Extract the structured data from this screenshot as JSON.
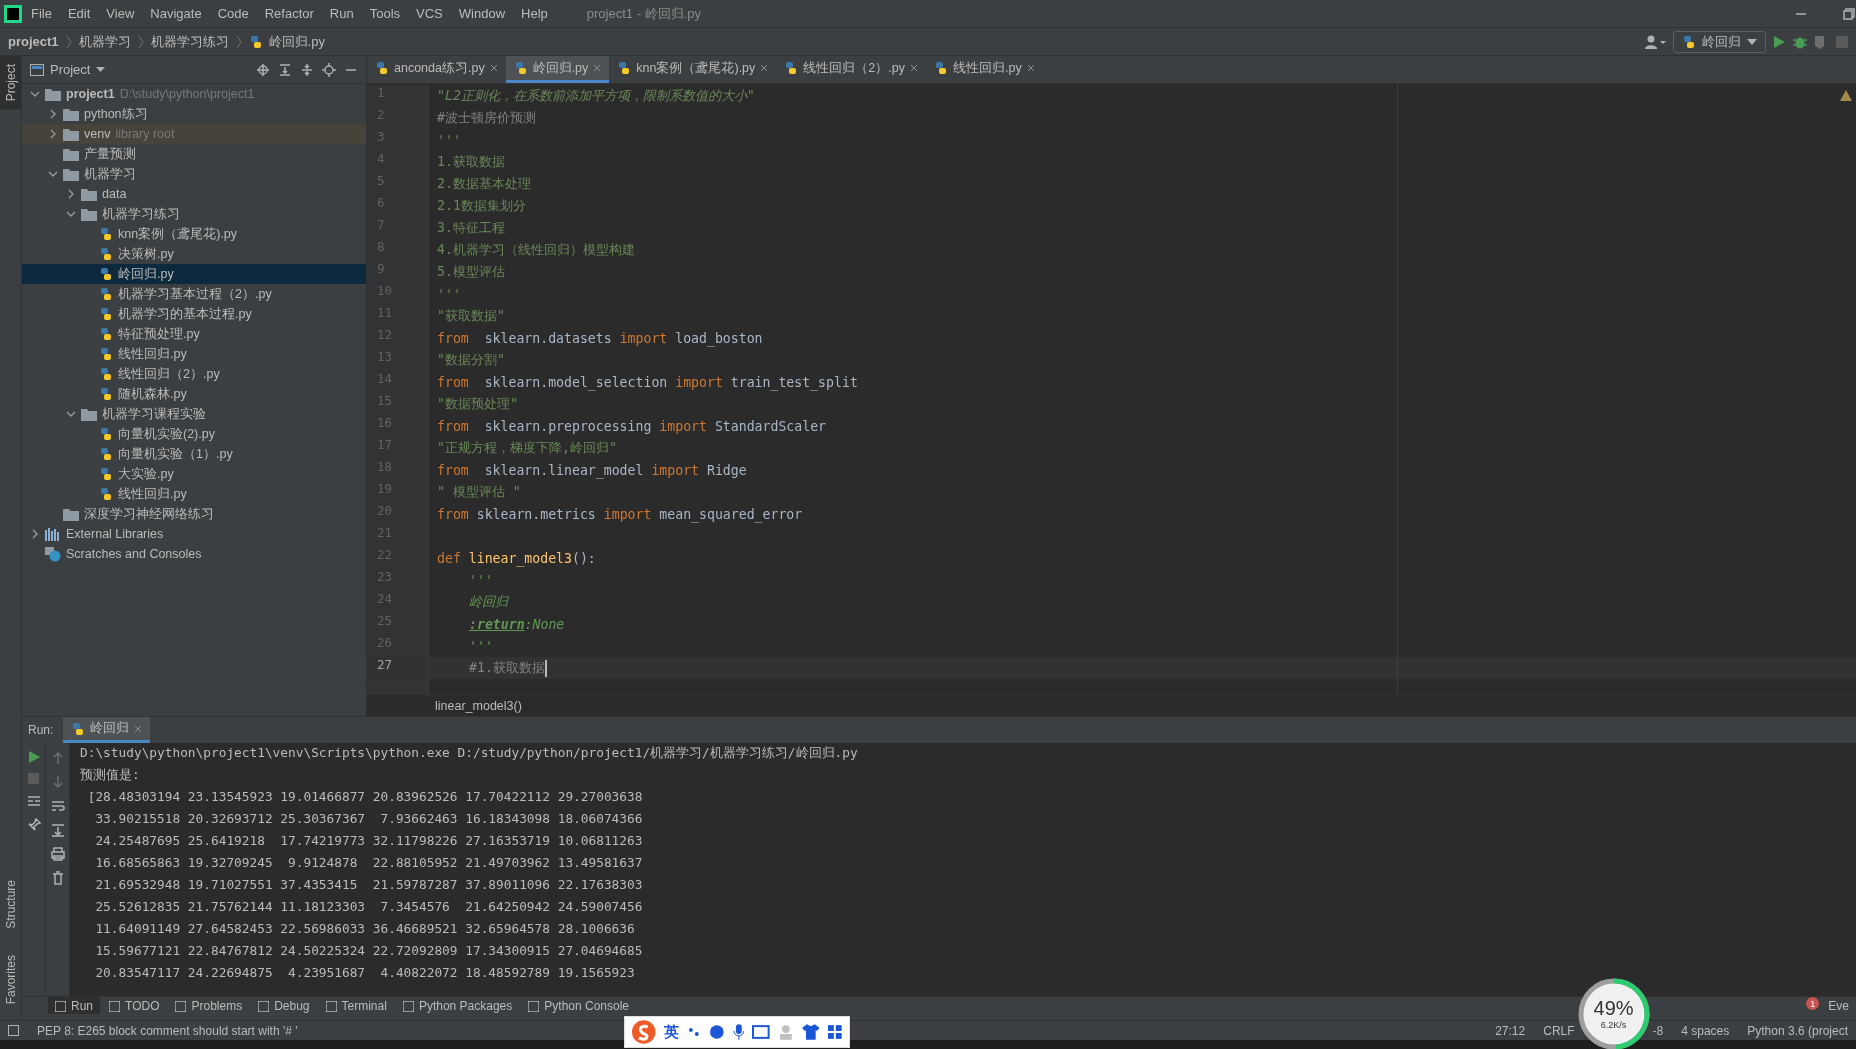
{
  "window": {
    "title": "project1 - 岭回归.py"
  },
  "menu": [
    "File",
    "Edit",
    "View",
    "Navigate",
    "Code",
    "Refactor",
    "Run",
    "Tools",
    "VCS",
    "Window",
    "Help"
  ],
  "breadcrumbs": [
    "project1",
    "机器学习",
    "机器学习练习",
    "岭回归.py"
  ],
  "run_config": {
    "label": "岭回归"
  },
  "side_strip": {
    "top": [
      {
        "label": "Project",
        "selected": true
      }
    ],
    "bottom": [
      {
        "label": "Structure",
        "selected": false
      },
      {
        "label": "Favorites",
        "selected": false
      }
    ]
  },
  "project_panel": {
    "title": "Project",
    "tree": [
      {
        "label": "project1",
        "hint": "D:\\study\\python\\project1",
        "kind": "root",
        "expanded": true,
        "selected": false,
        "children": [
          {
            "label": "python练习",
            "kind": "folder",
            "expanded": false,
            "selected": false
          },
          {
            "label": "venv",
            "hint": "library root",
            "kind": "library",
            "expanded": false,
            "selected": false
          },
          {
            "label": "产量预测",
            "kind": "folder",
            "selected": false
          },
          {
            "label": "机器学习",
            "kind": "folder",
            "expanded": true,
            "selected": false,
            "children": [
              {
                "label": "data",
                "kind": "folder",
                "expanded": false,
                "selected": false
              },
              {
                "label": "机器学习练习",
                "kind": "folder",
                "expanded": true,
                "selected": false,
                "children": [
                  {
                    "label": "knn案例（鸢尾花).py",
                    "kind": "file",
                    "selected": false
                  },
                  {
                    "label": "决策树.py",
                    "kind": "file",
                    "selected": false
                  },
                  {
                    "label": "岭回归.py",
                    "kind": "file",
                    "selected": true
                  },
                  {
                    "label": "机器学习基本过程（2）.py",
                    "kind": "file",
                    "selected": false
                  },
                  {
                    "label": "机器学习的基本过程.py",
                    "kind": "file",
                    "selected": false
                  },
                  {
                    "label": "特征预处理.py",
                    "kind": "file",
                    "selected": false
                  },
                  {
                    "label": "线性回归.py",
                    "kind": "file",
                    "selected": false
                  },
                  {
                    "label": "线性回归（2）.py",
                    "kind": "file",
                    "selected": false
                  },
                  {
                    "label": "随机森林.py",
                    "kind": "file",
                    "selected": false
                  }
                ]
              },
              {
                "label": "机器学习课程实验",
                "kind": "folder",
                "expanded": true,
                "selected": false,
                "children": [
                  {
                    "label": "向量机实验(2).py",
                    "kind": "file",
                    "selected": false
                  },
                  {
                    "label": "向量机实验（1）.py",
                    "kind": "file",
                    "selected": false
                  },
                  {
                    "label": "大实验.py",
                    "kind": "file",
                    "selected": false
                  },
                  {
                    "label": "线性回归.py",
                    "kind": "file",
                    "selected": false
                  }
                ]
              }
            ]
          },
          {
            "label": "深度学习神经网络练习",
            "kind": "folder",
            "selected": false
          }
        ]
      },
      {
        "label": "External Libraries",
        "kind": "libraries",
        "expanded": false,
        "selected": false
      },
      {
        "label": "Scratches and Consoles",
        "kind": "scratches",
        "selected": false
      }
    ]
  },
  "editor": {
    "tabs": [
      {
        "label": "anconda练习.py",
        "selected": false
      },
      {
        "label": "岭回归.py",
        "selected": true
      },
      {
        "label": "knn案例（鸢尾花).py",
        "selected": false
      },
      {
        "label": "线性回归（2）.py",
        "selected": false
      },
      {
        "label": "线性回归.py",
        "selected": false
      }
    ],
    "lines": [
      {
        "number": "1",
        "current": false,
        "tokens": [
          {
            "kind": "istring",
            "text": "\"L2正则化，在系数前添加平方项，限制系数值的大小\""
          }
        ]
      },
      {
        "number": "2",
        "current": false,
        "tokens": [
          {
            "kind": "comment",
            "text": "#波士顿房价预测"
          }
        ]
      },
      {
        "number": "3",
        "current": false,
        "tokens": [
          {
            "kind": "string",
            "text": "'''"
          }
        ]
      },
      {
        "number": "4",
        "current": false,
        "tokens": [
          {
            "kind": "string",
            "text": "1.获取数据"
          }
        ]
      },
      {
        "number": "5",
        "current": false,
        "tokens": [
          {
            "kind": "string",
            "text": "2.数据基本处理"
          }
        ]
      },
      {
        "number": "6",
        "current": false,
        "tokens": [
          {
            "kind": "string",
            "text": "2.1数据集划分"
          }
        ]
      },
      {
        "number": "7",
        "current": false,
        "tokens": [
          {
            "kind": "string",
            "text": "3.特征工程"
          }
        ]
      },
      {
        "number": "8",
        "current": false,
        "tokens": [
          {
            "kind": "string",
            "text": "4.机器学习（线性回归）模型构建"
          }
        ]
      },
      {
        "number": "9",
        "current": false,
        "tokens": [
          {
            "kind": "string",
            "text": "5.模型评估"
          }
        ]
      },
      {
        "number": "10",
        "current": false,
        "tokens": [
          {
            "kind": "string",
            "text": "'''"
          }
        ]
      },
      {
        "number": "11",
        "current": false,
        "tokens": [
          {
            "kind": "string",
            "text": "\"获取数据\""
          }
        ]
      },
      {
        "number": "12",
        "current": false,
        "tokens": [
          {
            "kind": "keyword",
            "text": "from"
          },
          {
            "kind": "plain",
            "text": "  sklearn.datasets "
          },
          {
            "kind": "keyword",
            "text": "import"
          },
          {
            "kind": "plain",
            "text": " load_boston"
          }
        ]
      },
      {
        "number": "13",
        "current": false,
        "tokens": [
          {
            "kind": "string",
            "text": "\"数据分割\""
          }
        ]
      },
      {
        "number": "14",
        "current": false,
        "tokens": [
          {
            "kind": "keyword",
            "text": "from"
          },
          {
            "kind": "plain",
            "text": "  sklearn.model_selection "
          },
          {
            "kind": "keyword",
            "text": "import"
          },
          {
            "kind": "plain",
            "text": " train_test_split"
          }
        ]
      },
      {
        "number": "15",
        "current": false,
        "tokens": [
          {
            "kind": "string",
            "text": "\"数据预处理\""
          }
        ]
      },
      {
        "number": "16",
        "current": false,
        "tokens": [
          {
            "kind": "keyword",
            "text": "from"
          },
          {
            "kind": "plain",
            "text": "  sklearn.preprocessing "
          },
          {
            "kind": "keyword",
            "text": "import"
          },
          {
            "kind": "plain",
            "text": " StandardScaler"
          }
        ]
      },
      {
        "number": "17",
        "current": false,
        "tokens": [
          {
            "kind": "string",
            "text": "\"正规方程，梯度下降,岭回归\""
          }
        ]
      },
      {
        "number": "18",
        "current": false,
        "tokens": [
          {
            "kind": "keyword",
            "text": "from"
          },
          {
            "kind": "plain",
            "text": "  sklearn.linear_model "
          },
          {
            "kind": "keyword",
            "text": "import"
          },
          {
            "kind": "plain",
            "text": " Ridge"
          }
        ]
      },
      {
        "number": "19",
        "current": false,
        "tokens": [
          {
            "kind": "string",
            "text": "\" 模型评估 \""
          }
        ]
      },
      {
        "number": "20",
        "current": false,
        "tokens": [
          {
            "kind": "keyword",
            "text": "from"
          },
          {
            "kind": "plain",
            "text": " sklearn.metrics "
          },
          {
            "kind": "keyword",
            "text": "import"
          },
          {
            "kind": "plain",
            "text": " mean_squared_error"
          }
        ]
      },
      {
        "number": "21",
        "current": false
      },
      {
        "number": "22",
        "current": false,
        "tokens": [
          {
            "kind": "keyword",
            "text": "def "
          },
          {
            "kind": "function",
            "text": "linear_model3"
          },
          {
            "kind": "plain",
            "text": "():"
          }
        ]
      },
      {
        "number": "23",
        "current": false,
        "indented": true,
        "tokens": [
          {
            "kind": "doc",
            "text": "'''"
          }
        ]
      },
      {
        "number": "24",
        "current": false,
        "indented": true,
        "tokens": [
          {
            "kind": "doc",
            "text": "岭回归"
          }
        ]
      },
      {
        "number": "25",
        "current": false,
        "indented": true,
        "tokens": [
          {
            "kind": "doctag",
            "text": ":return"
          },
          {
            "kind": "doc",
            "text": ":None"
          }
        ]
      },
      {
        "number": "26",
        "current": false,
        "indented": true,
        "tokens": [
          {
            "kind": "doc",
            "text": "'''"
          }
        ]
      },
      {
        "number": "27",
        "current": true,
        "indented": true,
        "tokens": [
          {
            "kind": "comment",
            "text": "#1.获取数据"
          }
        ]
      }
    ],
    "breadcrumb": "linear_model3()"
  },
  "run_panel": {
    "label": "Run:",
    "tabs": [
      {
        "label": "岭回归",
        "selected": true
      }
    ],
    "output": [
      "D:\\study\\python\\project1\\venv\\Scripts\\python.exe D:/study/python/project1/机器学习/机器学习练习/岭回归.py",
      "预测值是:",
      " [28.48303194 23.13545923 19.01466877 20.83962526 17.70422112 29.27003638",
      "  33.90215518 20.32693712 25.30367367  7.93662463 16.18343098 18.06074366",
      "  24.25487695 25.6419218  17.74219773 32.11798226 27.16353719 10.06811263",
      "  16.68565863 19.32709245  9.9124878  22.88105952 21.49703962 13.49581637",
      "  21.69532948 19.71027551 37.4353415  21.59787287 37.89011096 22.17638303",
      "  25.52612835 21.75762144 11.18123303  7.3454576  21.64250942 24.59007456",
      "  11.64091149 27.64582453 22.56986033 36.46689521 32.65964578 28.1006636",
      "  15.59677121 22.84767812 24.50225324 22.72092809 17.34300915 27.04694685",
      "  20.83547117 24.22694875  4.23951687  4.40822072 18.48592789 19.1565923"
    ]
  },
  "tool_tabs": [
    {
      "label": "Run",
      "selected": true
    },
    {
      "label": "TODO",
      "selected": false
    },
    {
      "label": "Problems",
      "selected": false
    },
    {
      "label": "Debug",
      "selected": false
    },
    {
      "label": "Terminal",
      "selected": false
    },
    {
      "label": "Python Packages",
      "selected": false
    },
    {
      "label": "Python Console",
      "selected": false
    }
  ],
  "event_log": {
    "count": "1",
    "label": "Eve"
  },
  "status_bar": {
    "message": "PEP 8: E265 block comment should start with '# '",
    "items": [
      "27:12",
      "CRLF",
      "-8",
      "4 spaces",
      "Python 3.6 (project"
    ]
  },
  "net_widget": {
    "percent": "49",
    "unit": "%",
    "speed": "6.2K/s",
    "level": 0.49
  },
  "ime_bar": {
    "label": "英"
  }
}
